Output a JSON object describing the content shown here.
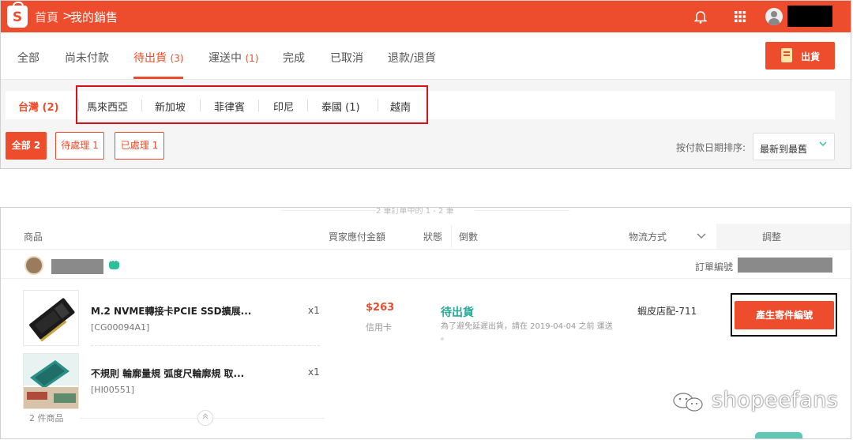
{
  "header": {
    "logo_letter": "S",
    "breadcrumb_home": "首頁",
    "breadcrumb_sep": ">",
    "breadcrumb_current": "我的銷售",
    "icons": [
      "bell-icon",
      "apps-grid-icon",
      "user-avatar-icon"
    ],
    "brand_color": "#ee4d2d"
  },
  "tabs": [
    {
      "label": "全部",
      "count": ""
    },
    {
      "label": "尚未付款",
      "count": ""
    },
    {
      "label": "待出貨",
      "count": "(3)"
    },
    {
      "label": "運送中",
      "count": "(1)"
    },
    {
      "label": "完成",
      "count": ""
    },
    {
      "label": "已取消",
      "count": ""
    },
    {
      "label": "退款/退貨",
      "count": ""
    }
  ],
  "active_tab": "待出貨",
  "ship_button_label": "出貨",
  "countries": [
    {
      "label": "台灣",
      "count": "(2)"
    },
    {
      "label": "馬來西亞",
      "count": ""
    },
    {
      "label": "新加坡",
      "count": ""
    },
    {
      "label": "菲律賓",
      "count": ""
    },
    {
      "label": "印尼",
      "count": ""
    },
    {
      "label": "泰國",
      "count": "(1)"
    },
    {
      "label": "越南",
      "count": ""
    }
  ],
  "filters": [
    {
      "label": "全部 2"
    },
    {
      "label": "待處理 1"
    },
    {
      "label": "已處理 1"
    }
  ],
  "sort": {
    "label": "按付款日期排序:",
    "value": "最新到最舊"
  },
  "order_list": {
    "pager_text": "2 筆訂單中的 1 - 2 筆",
    "columns": [
      "商品",
      "買家應付金額",
      "狀態",
      "倒數",
      "物流方式",
      "調整"
    ],
    "order_number_label": "訂單編號",
    "items": [
      {
        "name": "M.2 NVME轉接卡PCIE SSD擴展...",
        "sku": "[CG00094A1]",
        "qty": "x1"
      },
      {
        "name": "不規則 輪廓量規 弧度尺輪廓規 取...",
        "sku": "[HI00551]",
        "qty": "x1"
      }
    ],
    "price": "$263",
    "payment_method": "信用卡",
    "status": "待出貨",
    "status_note": "為了避免延遲出貨，請在 2019-04-04 之前 運送 。",
    "logistics": "蝦皮店配-711",
    "action_button": "產生寄件編號",
    "items_count": "2 件商品",
    "status_color": "#26aa99"
  },
  "watermark": "shopeefans"
}
